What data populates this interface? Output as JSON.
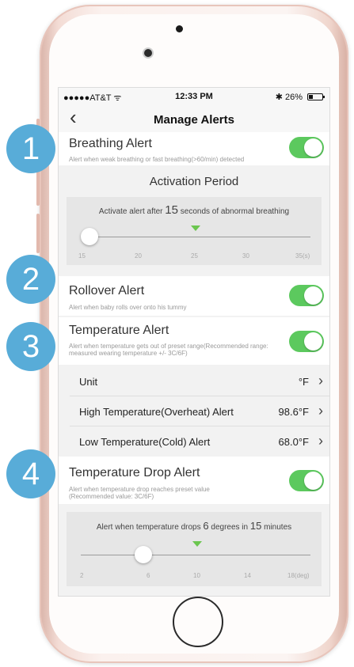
{
  "status_bar": {
    "carrier": "●●●●●AT&T ᯤ",
    "time": "12:33 PM",
    "battery": "✱ 26%"
  },
  "nav": {
    "back_icon": "chevron-left-icon",
    "title": "Manage Alerts"
  },
  "breathing": {
    "title": "Breathing Alert",
    "desc": "Alert when weak breathing or fast breathing(>60/min) detected",
    "enabled": true,
    "activation_title": "Activation Period",
    "activation_prefix": "Activate alert after",
    "activation_value": "15",
    "activation_suffix": "seconds of abnormal breathing",
    "ticks": [
      "15",
      "20",
      "25",
      "30",
      "35(s)"
    ]
  },
  "rollover": {
    "title": "Rollover Alert",
    "desc": "Alert when baby rolls over onto his tummy",
    "enabled": true
  },
  "temperature": {
    "title": "Temperature Alert",
    "desc": "Alert when temperature gets out of preset range(Recommended range: measured wearing temperature +/- 3C/6F)",
    "enabled": true,
    "rows": [
      {
        "label": "Unit",
        "value": "°F"
      },
      {
        "label": "High Temperature(Overheat) Alert",
        "value": "98.6°F"
      },
      {
        "label": "Low Temperature(Cold) Alert",
        "value": "68.0°F"
      }
    ]
  },
  "temp_drop": {
    "title": "Temperature Drop Alert",
    "desc": "Alert when temperature drop reaches preset value (Recommended value: 3C/6F)",
    "enabled": true,
    "prefix": "Alert when temperature drops",
    "degrees": "6",
    "middle": "degrees in",
    "minutes": "15",
    "suffix": "minutes",
    "ticks": [
      "2",
      "6",
      "10",
      "14",
      "18(deg)"
    ]
  },
  "badges": [
    "1",
    "2",
    "3",
    "4"
  ],
  "colors": {
    "toggle_on": "#5cc95e",
    "badge": "#58acd8",
    "marker": "#6bc64f"
  }
}
